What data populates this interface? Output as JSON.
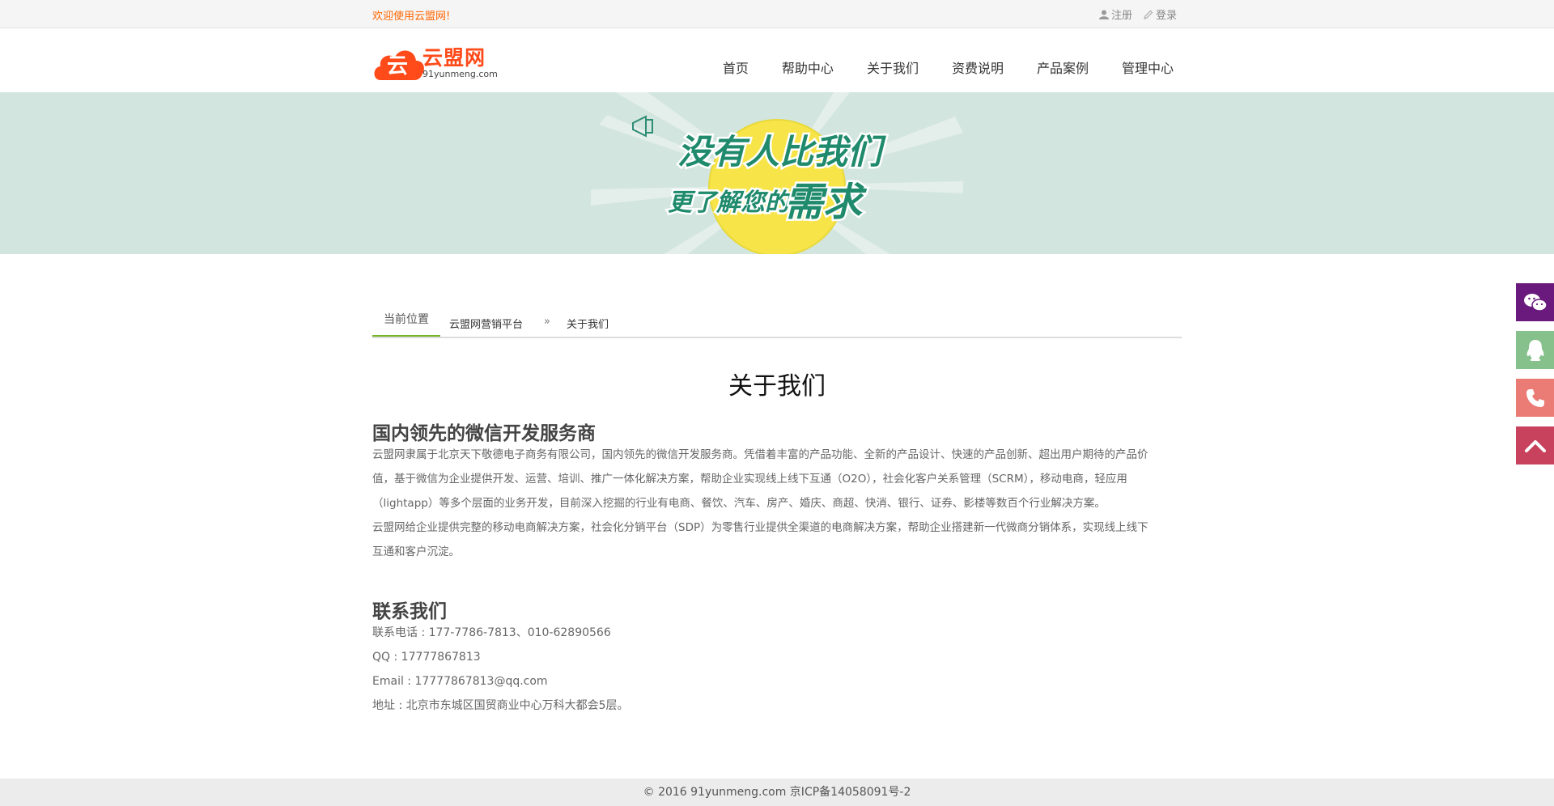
{
  "topbar": {
    "welcome": "欢迎使用云盟网!",
    "register": "注册",
    "login": "登录"
  },
  "logo": {
    "glyph": "云",
    "name": "云盟网",
    "domain": "91yunmeng.com"
  },
  "nav": [
    "首页",
    "帮助中心",
    "关于我们",
    "资费说明",
    "产品案例",
    "管理中心"
  ],
  "banner": {
    "line1": "没有人比我们",
    "line2_a": "更了解您的",
    "line2_b": "需求"
  },
  "breadcrumb": {
    "here": "当前位置",
    "home": "云盟网营销平台",
    "sep": "»",
    "current": "关于我们"
  },
  "page_title": "关于我们",
  "section1": {
    "heading": "国内领先的微信开发服务商",
    "p1_l1": "云盟网隶属于北京天下敬德电子商务有限公司，国内领先的微信开发服务商。凭借着丰富的产品功能、全新的产品设计、快速的产品创新、超出用户期待的产品价",
    "p1_l2": "值，基于微信为企业提供开发、运营、培训、推广一体化解决方案，帮助企业实现线上线下互通（O2O），社会化客户关系管理（SCRM），移动电商，轻应用",
    "p1_l3": "（lightapp）等多个层面的业务开发，目前深入挖掘的行业有电商、餐饮、汽车、房产、婚庆、商超、快消、银行、证券、影楼等数百个行业解决方案。",
    "p2_l1": "云盟网给企业提供完整的移动电商解决方案，社会化分销平台（SDP）为零售行业提供全渠道的电商解决方案，帮助企业搭建新一代微商分销体系，实现线上线下",
    "p2_l2": "互通和客户沉淀。"
  },
  "section2": {
    "heading": "联系我们",
    "phone": "联系电话 : 177-7786-7813、010-62890566",
    "qq": "QQ : 17777867813",
    "email": "Email : 17777867813@qq.com",
    "address": "地址 : 北京市东城区国贸商业中心万科大都会5层。"
  },
  "footer": "© 2016 91yunmeng.com 京ICP备14058091号-2",
  "colors": {
    "brand": "#ff4a1a",
    "welcome": "#ff6600",
    "banner_bg": "#d2e5df",
    "crumb_accent": "#74b52a",
    "side_wechat": "#6a1a7c",
    "side_qq": "#86c18b",
    "side_phone": "#ea7b75",
    "side_top": "#c8415d"
  },
  "side_buttons": [
    "wechat-icon",
    "qq-icon",
    "phone-icon",
    "back-to-top-icon"
  ]
}
